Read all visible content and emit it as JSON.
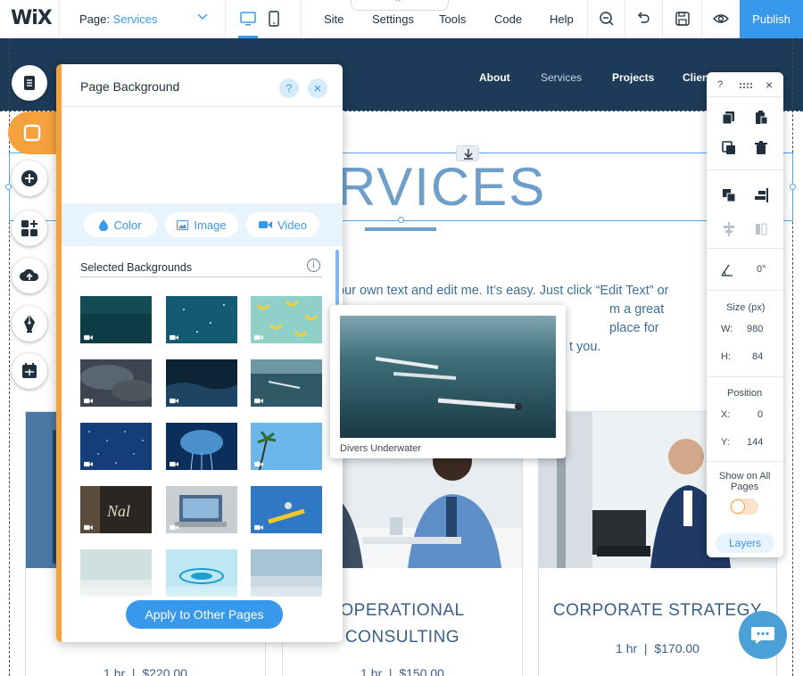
{
  "topbar": {
    "logo": "WiX",
    "page_label": "Page:",
    "page_value": "Services",
    "menu": [
      "Site",
      "Settings",
      "Tools",
      "Code",
      "Help"
    ],
    "tab_handle": "^",
    "publish": "Publish"
  },
  "site": {
    "nav": [
      "About",
      "Services",
      "Projects",
      "Clien"
    ],
    "title": "RVICES",
    "body_text": "our own text and edit me. It's easy. Just click “Edit Text” or                                                  m a great place for                                                  t you.",
    "body_line1": "our own text and edit me. It’s easy. Just click “Edit Text” or",
    "body_line2": "m a great place for",
    "body_line3": "t you.",
    "cards": [
      {
        "title": "",
        "meta_time": "1 hr",
        "meta_price": "$220.00"
      },
      {
        "title_line1": "OPERATIONAL",
        "title_line2": "CONSULTING",
        "meta_time": "1 hr",
        "meta_price": "$150.00"
      },
      {
        "title": "CORPORATE STRATEGY",
        "meta_time": "1 hr",
        "meta_price": "$170.00"
      }
    ]
  },
  "panel": {
    "title": "Page Background",
    "help": "?",
    "close": "×",
    "types": [
      "Color",
      "Image",
      "Video"
    ],
    "section_label": "Selected Backgrounds",
    "info": "i",
    "apply": "Apply to Other Pages"
  },
  "preview": {
    "caption": "Divers Underwater"
  },
  "right_toolbar": {
    "help": "?",
    "close": "×",
    "rotation": "0°",
    "size_label": "Size (px)",
    "w_label": "W:",
    "w_value": "980",
    "h_label": "H:",
    "h_value": "84",
    "position_label": "Position",
    "x_label": "X:",
    "x_value": "0",
    "y_label": "Y:",
    "y_value": "144",
    "show_on_all_line1": "Show on All",
    "show_on_all_line2": "Pages",
    "layers": "Layers"
  },
  "colors": {
    "accent": "#3899ec",
    "panel_accent": "#f5a13d",
    "header_bg": "#1d3a58",
    "title_color": "#6e9fca"
  }
}
